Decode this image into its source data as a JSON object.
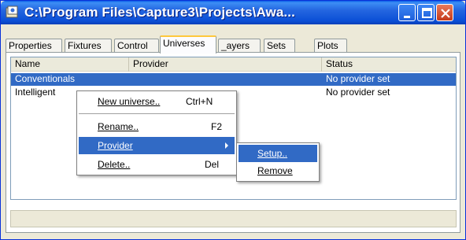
{
  "window": {
    "title": "C:\\Program Files\\Capture3\\Projects\\Awa...",
    "icon": "app-icon",
    "controls": [
      "minimize-icon",
      "maximize-icon",
      "close-icon"
    ]
  },
  "tabs": [
    {
      "label": "Properties"
    },
    {
      "label": "Fixtures"
    },
    {
      "label": "Control"
    },
    {
      "label": "Universes",
      "active": true
    },
    {
      "label": "_ayers"
    },
    {
      "label": "Sets"
    },
    {
      "label": "Plots"
    }
  ],
  "list": {
    "columns": [
      "Name",
      "Provider",
      "Status"
    ],
    "rows": [
      {
        "name": "Conventionals",
        "provider": "",
        "status": "No provider set",
        "selected": true
      },
      {
        "name": "Intelligent",
        "provider": "",
        "status": "No provider set",
        "selected": false
      }
    ]
  },
  "context_menu": {
    "items": [
      {
        "label": "New universe..",
        "shortcut": "Ctrl+N"
      },
      {
        "label": "Rename..",
        "shortcut": "F2"
      },
      {
        "label": "Provider",
        "submenu": true,
        "highlighted": true
      },
      {
        "label": "Delete..",
        "shortcut": "Del"
      }
    ]
  },
  "submenu": {
    "items": [
      {
        "label": "Setup..",
        "highlighted": true
      },
      {
        "label": "Remove"
      }
    ]
  },
  "colors": {
    "selection": "#316ac5",
    "titlebar": "#0b4fd6",
    "active_tab_accent": "#ffc83c"
  }
}
